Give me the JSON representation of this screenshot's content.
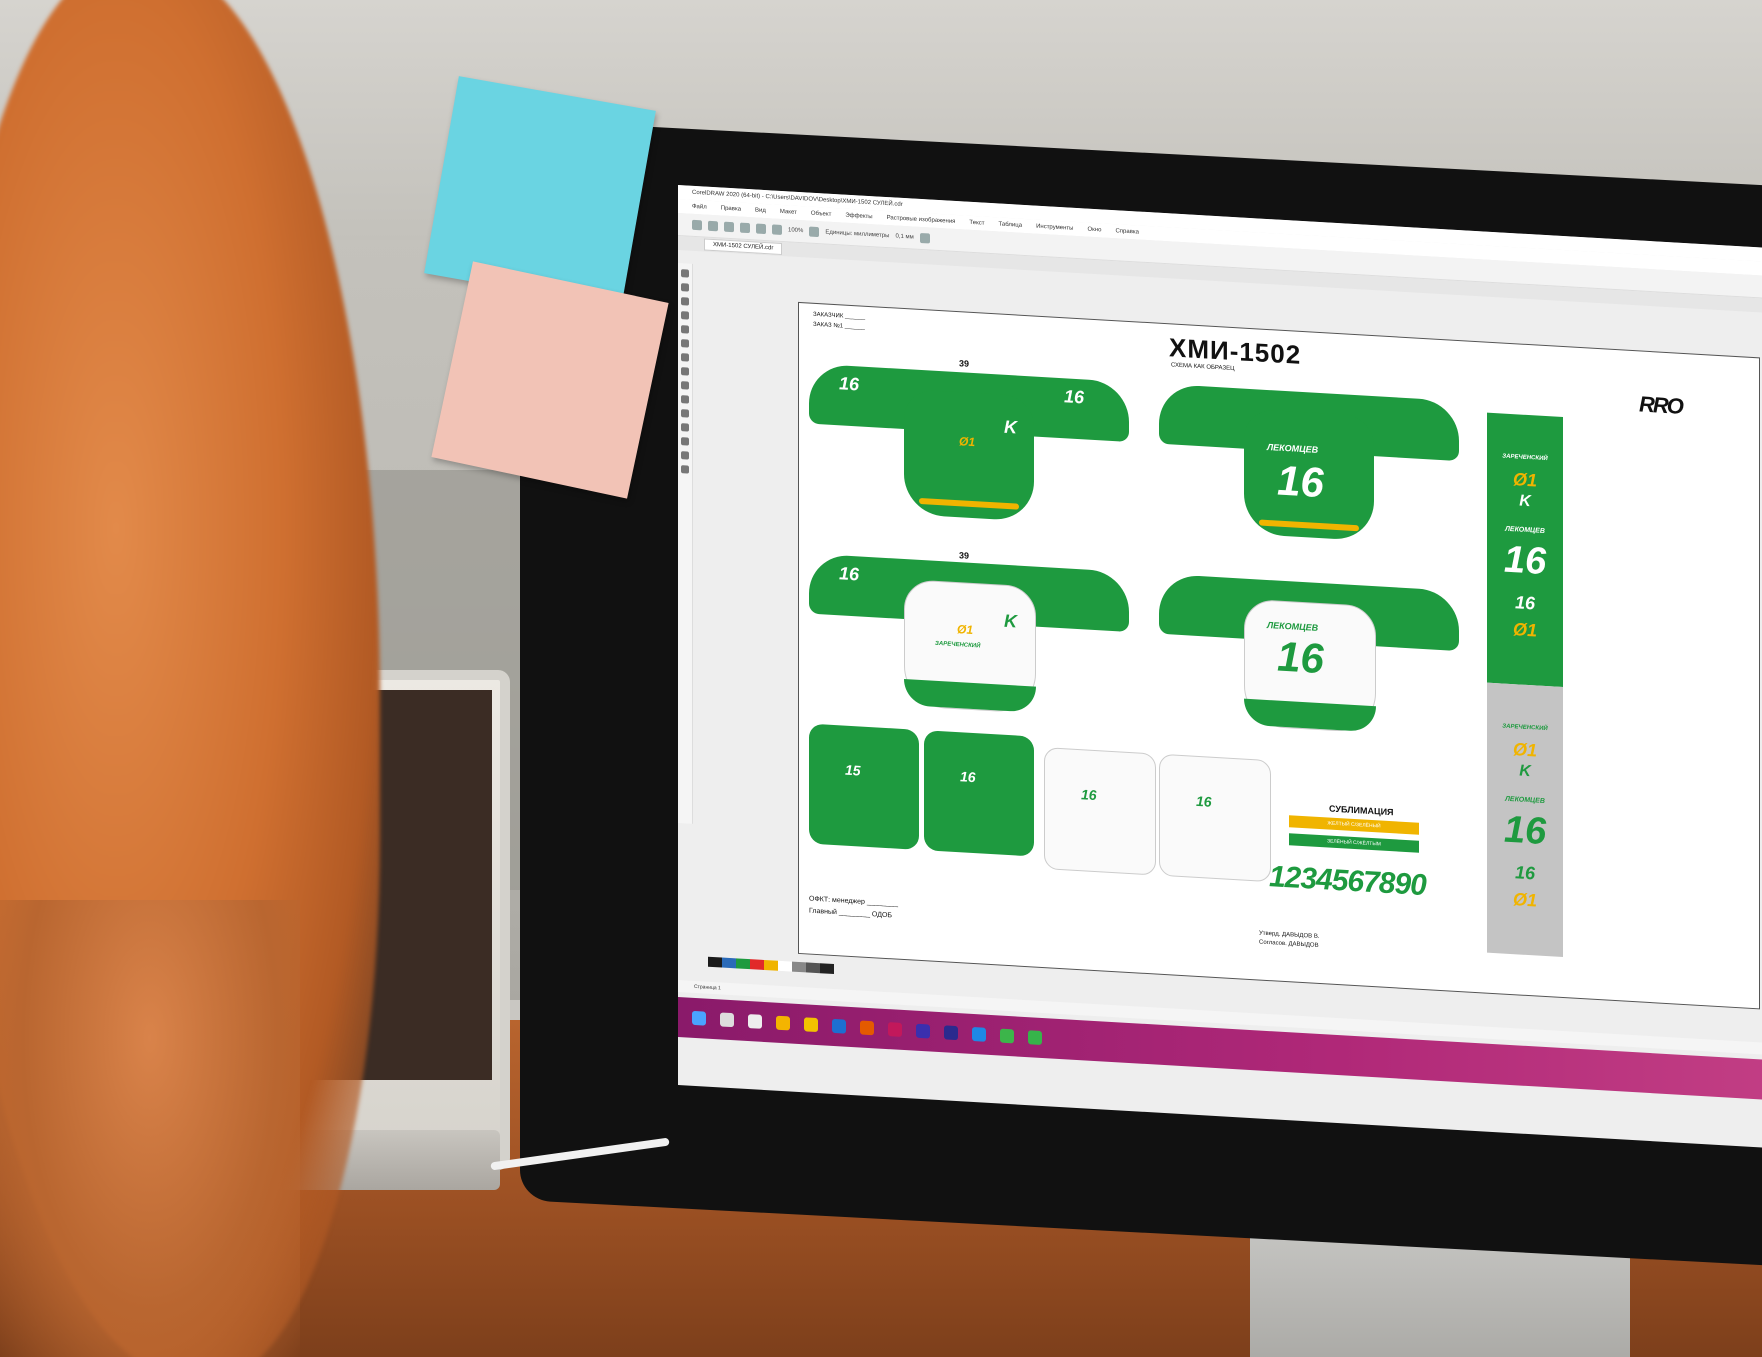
{
  "app": {
    "window_title": "CorelDRAW 2020 (64-bit) - C:\\Users\\DAVIDOV\\Desktop\\ХМИ-1502 СУЛЕЙ.cdr",
    "menu": [
      "Файл",
      "Правка",
      "Вид",
      "Макет",
      "Объект",
      "Эффекты",
      "Растровые изображения",
      "Текст",
      "Таблица",
      "Инструменты",
      "Окно",
      "Справка"
    ],
    "zoom": "100%",
    "tab_label": "ХМИ-1502 СУЛЕЙ.cdr",
    "units_label": "Единицы: миллиметры",
    "nudge": "0,1 мм",
    "page_nav": "Страница 1"
  },
  "document": {
    "title": "ХМИ-1502",
    "subtitle": "СХЕМА КАК ОБРАЗЕЦ",
    "head_left": [
      "ЗАКАЗЧИК ______",
      "ЗАКАЗ №1 ______"
    ],
    "size_top": "39",
    "size_mid": "39",
    "player_name": "ЛЕКОМЦЕВ",
    "number": "16",
    "chest_letter": "K",
    "chest_num": "Ø1",
    "sponsor": "ЗАРЕЧЕНСКИЙ",
    "shorts_numbers": [
      "15",
      "16",
      "16",
      "16"
    ],
    "sublimation_title": "СУБЛИМАЦИЯ",
    "sublimation_bars": [
      "ЖЕЛТЫЙ С/ЗЕЛЁНЫЙ",
      "ЗЕЛЁНЫЙ С/ЖЁЛТЫМ"
    ],
    "digits": "1234567890",
    "side_panel_green": [
      "ЗАРЕЧЕНСКИЙ",
      "Ø1",
      "K",
      "ЛЕКОМЦЕВ",
      "16",
      "16",
      "Ø1"
    ],
    "side_panel_gray": [
      "ЗАРЕЧЕНСКИЙ",
      "Ø1",
      "K",
      "ЛЕКОМЦЕВ",
      "16",
      "16",
      "Ø1"
    ],
    "bottom_left": [
      "ОФКТ: менеджер ________",
      "Главный ________ ОДОБ"
    ],
    "signature": [
      "Утверд. ДАВЫДОВ В.",
      "Согласов. ДАВЫДОВ"
    ],
    "logo": "RRO"
  },
  "colors": {
    "green": "#1e9a3f",
    "yellow": "#f0b400",
    "white": "#fafafa",
    "taskbar": "#b02878"
  },
  "palette": [
    "#1a1a1a",
    "#2a6ab8",
    "#1e9a3f",
    "#e12a2a",
    "#f0b400",
    "#ffffff",
    "#888888",
    "#555555",
    "#222222"
  ]
}
